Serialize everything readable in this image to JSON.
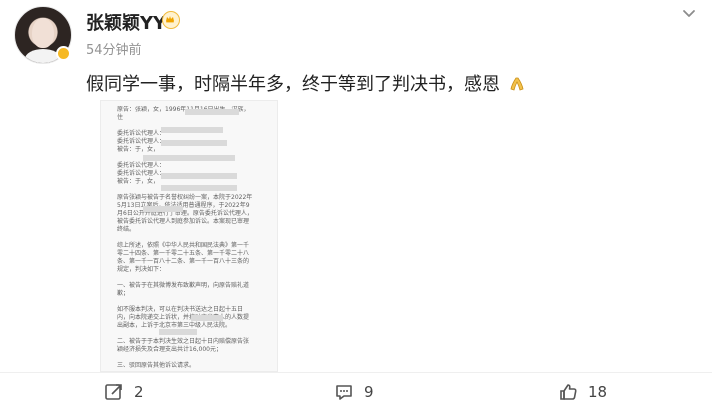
{
  "user": {
    "name": "张颖颖YY",
    "time": "54分钟前",
    "avatar_label": "avatar"
  },
  "post": {
    "text": "假同学一事，时隔半年多，终于等到了判决书，感恩",
    "emoji": "pray-hands-icon"
  },
  "document": {
    "text": "原告：张颖，女，1996年11月16日出生，汉族，住\n\n委托诉讼代理人：\n委托诉讼代理人：\n被告：于，女，\n\n委托诉讼代理人：\n委托诉讼代理人：\n被告：于，女，\n\n原告张颖与被告于名誉权纠纷一案，本院于2022年5月13日立案后，依法适用普通程序，于2022年9月6日公开开庭进行了审理。原告委托诉讼代理人，被告委托诉讼代理人到庭参加诉讼。本案现已审理终结。\n\n综上所述，依照《中华人民共和国民法典》第一千零二十四条、第一千零二十五条、第一千零二十八条、第一千一百八十二条、第一千一百八十三条的规定，判决如下：\n\n一、被告于在其微博发布致歉声明，向原告赔礼道歉；\n\n如不服本判决，可以在判决书送达之日起十五日内，向本院递交上诉状，并按对方当事人的人数提出副本，上诉于北京市第三中级人民法院。\n\n二、被告于于本判决生效之日起十日内赔偿原告张颖经济损失及合理支出共计16,000元；\n\n三、驳回原告其他诉讼请求。"
  },
  "actions": {
    "share": {
      "icon": "share-icon",
      "count": "2"
    },
    "comment": {
      "icon": "comment-icon",
      "count": "9"
    },
    "like": {
      "icon": "like-icon",
      "count": "18"
    }
  }
}
